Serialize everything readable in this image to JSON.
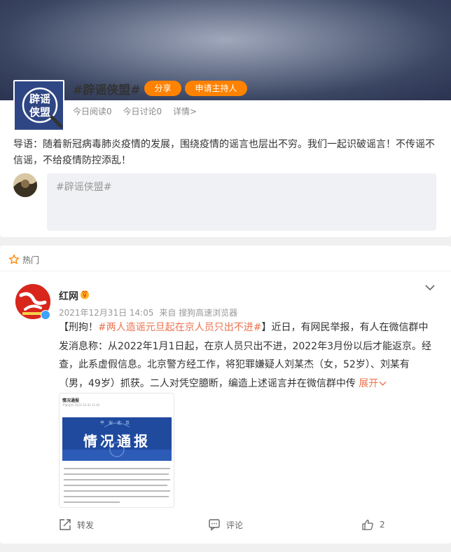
{
  "topic": {
    "title": "#辟谣侠盟#",
    "avatar_text": "辟谣侠盟",
    "share_label": "分享",
    "host_label": "申请主持人",
    "reads_label": "今日阅读0",
    "discussions_label": "今日讨论0",
    "details_label": "详情>",
    "intro": "导语：随着新冠病毒肺炎疫情的发展，围绕疫情的谣言也层出不穷。我们一起识破谣言！不传谣不信谣，不给疫情防控添乱！",
    "composer_placeholder": "#辟谣侠盟#"
  },
  "feed": {
    "hot_label": "热门",
    "post": {
      "author": "红网",
      "timestamp": "2021年12月31日 14:05",
      "source": "来自 搜狗高速浏览器",
      "body_prefix": "【刑拘！",
      "hashtag": "#两人造谣元旦起在京人员只出不进#",
      "body_rest": "】近日，有网民举报，有人在微信群中发消息称：从2022年1月1日起，在京人员只出不进，2022年3月份以后才能返京。经查，此系虚假信息。北京警方经工作，将犯罪嫌疑人刘某杰（女，52岁）、刘某有（男，49岁）抓获。二人对凭空臆断，编造上述谣言并在微信群中传",
      "expand_label": "展开",
      "image": {
        "title": "情况通报",
        "subtitle": "平安北京",
        "date": "2021-12-31 11:45",
        "banner_text": "情况通报",
        "banner_small": "平安北京"
      },
      "repost_label": "转发",
      "comment_label": "评论",
      "like_count": "2"
    }
  },
  "colors": {
    "accent": "#ff8200",
    "hashtag": "#eb7350",
    "verify": "#3ea2f8"
  }
}
